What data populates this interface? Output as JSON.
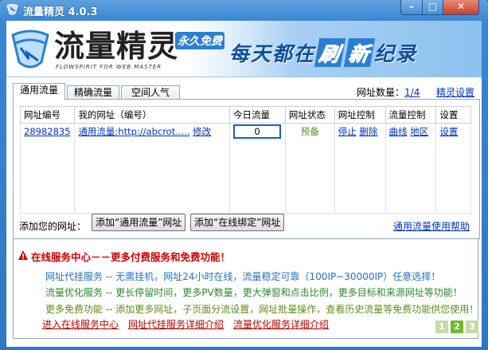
{
  "window": {
    "title": "流量精灵 4.0.3",
    "min": "–",
    "max": "□",
    "close": "✕"
  },
  "banner": {
    "logo": "流量精灵",
    "logo_sub": "FLOWSPIRIT FOR WEB MASTER",
    "free_tag": "永久免费",
    "slogan_a": "每天都在",
    "slogan_b": "刷",
    "slogan_c": "新",
    "slogan_d": "纪录"
  },
  "tabs": [
    {
      "label": "通用流量",
      "active": true
    },
    {
      "label": "精确流量",
      "active": false
    },
    {
      "label": "空间人气",
      "active": false
    }
  ],
  "site_count": {
    "label": "网址数量：",
    "value": "1/4"
  },
  "settings_link": "精灵设置",
  "table": {
    "headers": [
      "网址编号",
      "我的网址（编号）",
      "今日流量",
      "网址状态",
      "网址控制",
      "流量控制",
      "设置"
    ],
    "rows": [
      {
        "id": "28982835",
        "url": "通用流量:http://abcrot.....",
        "edit": "修改",
        "traffic": "0",
        "status": "预备",
        "stop": "停止",
        "delete": "删除",
        "curve": "曲线",
        "region": "地区",
        "settings": "设置"
      }
    ]
  },
  "add": {
    "label": "添加您的网址：",
    "btn_general": "添加“通用流量”网址",
    "btn_bind": "添加“在线绑定”网址"
  },
  "help_link": "通用流量使用帮助",
  "service": {
    "title": "在线服务中心－－更多付费服务和免费功能！",
    "line1": "网址代挂服务 -- 无需挂机，网址24小时在线，流量稳定可靠（100IP~30000IP）任意选择！",
    "line2": "流量优化服务 -- 更长停留时间，更多PV数量，更大弹窗和点击比例，更多目标和来源网址等功能！",
    "line3": "更多免费功能 -- 添加更多网址，子页面分流设置，网址批量操作，查看历史流量等免费功能供您使用！",
    "links": [
      "进入在线服务中心",
      "网址代挂服务详细介绍",
      "流量优化服务详细介绍"
    ],
    "pages": [
      "1",
      "2",
      "3"
    ],
    "active_page": "2"
  },
  "colors": {
    "accent": "#2b7fd3",
    "service_title": "#d10000",
    "link": "#0033cc"
  }
}
